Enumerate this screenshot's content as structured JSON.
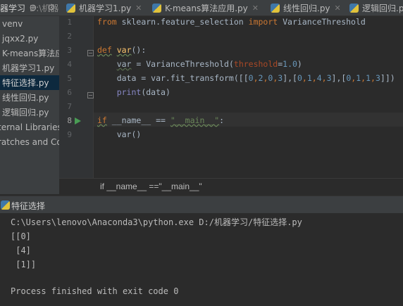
{
  "project": {
    "title": "器学习",
    "path": "D:\\机器学"
  },
  "file_tabs": [
    {
      "label": "机器学习1.py"
    },
    {
      "label": "K-means算法应用.py"
    },
    {
      "label": "线性回归.py"
    },
    {
      "label": "逻辑回归.py"
    }
  ],
  "tree": [
    {
      "label": "venv"
    },
    {
      "label": "jqxx2.py"
    },
    {
      "label": "K-means算法应"
    },
    {
      "label": "机器学习1.py"
    },
    {
      "label": "特征选择.py"
    },
    {
      "label": "线性回归.py"
    },
    {
      "label": "逻辑回归.py"
    },
    {
      "label": "ternal Libraries"
    },
    {
      "label": "ratches and Co"
    }
  ],
  "line_numbers": [
    "1",
    "2",
    "3",
    "4",
    "5",
    "6",
    "7",
    "8",
    "9"
  ],
  "code": {
    "l1": {
      "k1": "from",
      "t1": " sklearn.feature_selection ",
      "k2": "import",
      "t2": " VarianceThreshold"
    },
    "l3": {
      "k": "def",
      "sp": " ",
      "fn": "var",
      "rest": "():"
    },
    "l4": {
      "a": "    ",
      "v": "var",
      "b": " = VarianceThreshold(",
      "p": "threshold",
      "c": "=",
      "n": "1.0",
      "d": ")"
    },
    "l5": {
      "a": "    data = var.fit_transform([[",
      "n1": "0",
      "s1": ",",
      "n2": "2",
      "s2": ",",
      "n3": "0",
      "s3": ",",
      "n4": "3",
      "s4": "],[",
      "n5": "0",
      "s5": ",",
      "n6": "1",
      "s6": ",",
      "n7": "4",
      "s7": ",",
      "n8": "3",
      "s8": "],[",
      "n9": "0",
      "s9": ",",
      "n10": "1",
      "s10": ",",
      "n11": "1",
      "s11": ",",
      "n12": "3",
      "e": "]])"
    },
    "l6": {
      "a": "    ",
      "f": "print",
      "b": "(data)"
    },
    "l8": {
      "k": "if",
      "a": " __name__ ",
      "op": "==",
      "sp": " ",
      "s": "\"__main__\"",
      "c": ":"
    },
    "l9": {
      "a": "    var()"
    }
  },
  "breadcrumb": "if __name__ ==\"__main__\"",
  "run": {
    "title": "特征选择"
  },
  "console": [
    "C:\\Users\\lenovo\\Anaconda3\\python.exe D:/机器学习/特征选择.py",
    "[[0]",
    " [4]",
    " [1]]",
    "",
    "Process finished with exit code 0"
  ]
}
